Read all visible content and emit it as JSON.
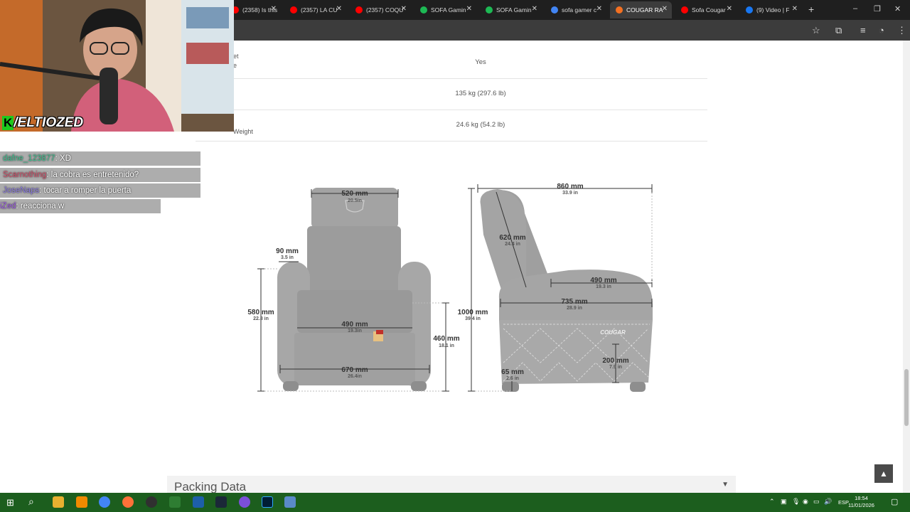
{
  "browser": {
    "tabs": [
      {
        "label": "(2358) Is this",
        "color": "#ff0000"
      },
      {
        "label": "(2357) LA CU",
        "color": "#ff0000"
      },
      {
        "label": "(2357) COQU",
        "color": "#ff0000"
      },
      {
        "label": "SOFA Gamin",
        "color": "#1db954"
      },
      {
        "label": "SOFA Gamin",
        "color": "#1db954"
      },
      {
        "label": "sofa gamer c",
        "color": "#4285f4"
      },
      {
        "label": "COUGAR RA",
        "color": "#f37021"
      },
      {
        "label": "Sofa Cougar",
        "color": "#ff0000"
      },
      {
        "label": "(9) Video | F",
        "color": "#1877f2"
      }
    ],
    "new_tab": "+",
    "window_controls": [
      "–",
      "❐",
      "✕"
    ],
    "toolbar_icons": [
      "star-icon",
      "extensions-icon",
      "media-icon",
      "profile-icon",
      "menu-icon"
    ]
  },
  "specs": {
    "rows": [
      {
        "label_lines": [
          "et",
          "e"
        ],
        "value": "Yes"
      },
      {
        "label_lines": [
          ""
        ],
        "value": "135 kg (297.6 lb)"
      },
      {
        "label_lines": [
          "Weight"
        ],
        "value": "24.6 kg (54.2 lb)"
      }
    ]
  },
  "diagram": {
    "front": {
      "top_width": {
        "mm": "520 mm",
        "in": "20.5in"
      },
      "arm_width": {
        "mm": "90 mm",
        "in": "3.5 in"
      },
      "arm_height": {
        "mm": "580 mm",
        "in": "22.8 in"
      },
      "seat_width": {
        "mm": "490 mm",
        "in": "19.3in"
      },
      "seat_height": {
        "mm": "460 mm",
        "in": "18.1 in"
      },
      "total_width": {
        "mm": "670 mm",
        "in": "26.4in"
      }
    },
    "side": {
      "depth": {
        "mm": "860 mm",
        "in": "33.9 in"
      },
      "back_height": {
        "mm": "620 mm",
        "in": "24.4 in"
      },
      "seat_depth": {
        "mm": "490 mm",
        "in": "19.3 in"
      },
      "arm_depth": {
        "mm": "735 mm",
        "in": "28.9 in"
      },
      "total_height": {
        "mm": "1000 mm",
        "in": "39.4 in"
      },
      "brand": "COUGAR",
      "footrest": {
        "mm": "200 mm",
        "in": "7.9 in"
      },
      "leg": {
        "mm": "65 mm",
        "in": "2.6 in"
      }
    }
  },
  "packing": {
    "title": "Packing Data",
    "chevron": "▼"
  },
  "scroll_top": "▲",
  "stream": {
    "channel": "/ELTIOZED",
    "channel_logo": "K",
    "chat": [
      {
        "user": "dafne_123877",
        "user_color": "#3fbf8f",
        "message": ": XD"
      },
      {
        "user": "Scarnothing",
        "user_color": "#d0506a",
        "message": ": la cobra es entretenido?"
      },
      {
        "user": "JoseNaps",
        "user_color": "#8a7adf",
        "message": ": tocar a romper la puerta"
      },
      {
        "user": "iZed",
        "user_color": "#9a5ae0",
        "message": ": reacciona w"
      }
    ]
  },
  "taskbar": {
    "lang": "ESP",
    "time": "18:54",
    "date": "11/01/2026"
  },
  "colors": {
    "taskbar": "#1c5e1e",
    "tabbar": "#1f1f1f",
    "toolbar": "#3c3c3c",
    "chair": "#9a9a9a"
  }
}
